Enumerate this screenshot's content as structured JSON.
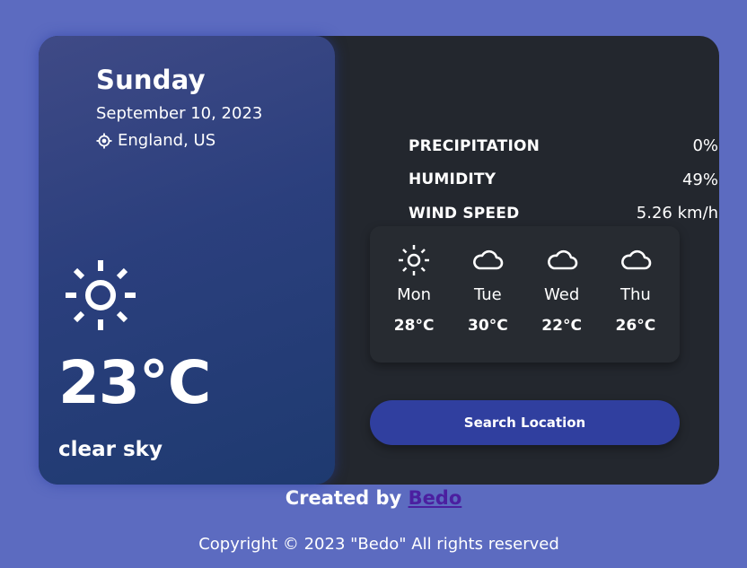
{
  "current": {
    "day": "Sunday",
    "date": "September 10, 2023",
    "location": "England, US",
    "location_icon": "location-pin-icon",
    "weather_icon": "sun-icon",
    "temperature": "23°C",
    "condition": "clear sky"
  },
  "stats": [
    {
      "label": "PRECIPITATION",
      "value": "0%"
    },
    {
      "label": "HUMIDITY",
      "value": "49%"
    },
    {
      "label": "WIND SPEED",
      "value": "5.26 km/h"
    }
  ],
  "forecast": [
    {
      "icon": "sun-icon",
      "day": "Mon",
      "temp": "28°C"
    },
    {
      "icon": "cloud-icon",
      "day": "Tue",
      "temp": "30°C"
    },
    {
      "icon": "cloud-icon",
      "day": "Wed",
      "temp": "22°C"
    },
    {
      "icon": "cloud-icon",
      "day": "Thu",
      "temp": "26°C"
    }
  ],
  "search_button": {
    "label": "Search Location"
  },
  "footer": {
    "credit_prefix": "Created by",
    "credit_link": "Bedo",
    "copyright": "Copyright © 2023 \"Bedo\" All rights reserved"
  },
  "colors": {
    "background": "#5c6bc0",
    "card": "#23272e",
    "button": "#303f9f",
    "link": "#4b1fa0"
  }
}
